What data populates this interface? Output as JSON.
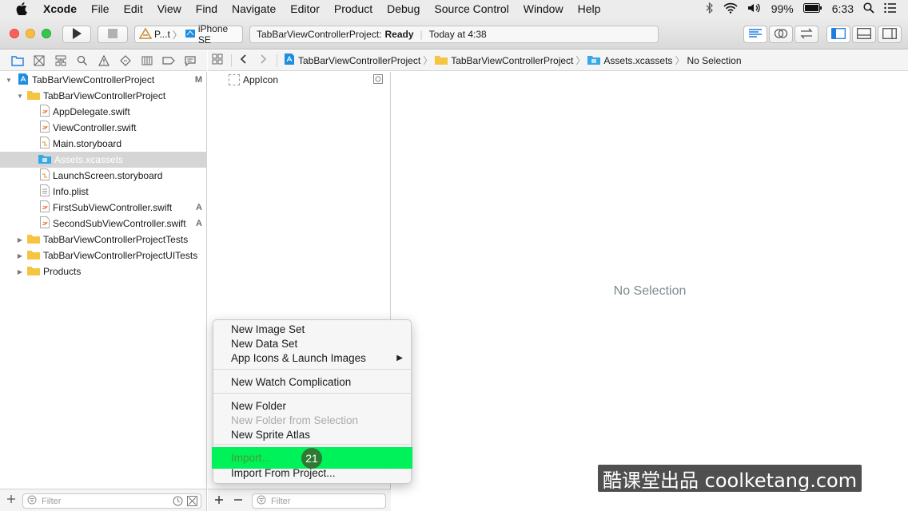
{
  "menubar": {
    "app": "Xcode",
    "items": [
      "File",
      "Edit",
      "View",
      "Find",
      "Navigate",
      "Editor",
      "Product",
      "Debug",
      "Source Control",
      "Window",
      "Help"
    ],
    "battery": "99%",
    "time": "6:33"
  },
  "toolbar": {
    "scheme_target": "P...t",
    "scheme_device": "iPhone SE",
    "status_project": "TabBarViewControllerProject:",
    "status_state": "Ready",
    "status_time": "Today at 4:38"
  },
  "jumpbar": {
    "crumbs": [
      "TabBarViewControllerProject",
      "TabBarViewControllerProject",
      "Assets.xcassets",
      "No Selection"
    ]
  },
  "navigator": {
    "rows": [
      {
        "label": "TabBarViewControllerProject",
        "badge": "M",
        "icon": "project-icon"
      },
      {
        "label": "TabBarViewControllerProject",
        "badge": "",
        "icon": "folder-icon"
      },
      {
        "label": "AppDelegate.swift",
        "badge": "",
        "icon": "swift-file-icon"
      },
      {
        "label": "ViewController.swift",
        "badge": "",
        "icon": "swift-file-icon"
      },
      {
        "label": "Main.storyboard",
        "badge": "",
        "icon": "storyboard-icon"
      },
      {
        "label": "Assets.xcassets",
        "badge": "",
        "icon": "asset-catalog-icon"
      },
      {
        "label": "LaunchScreen.storyboard",
        "badge": "",
        "icon": "storyboard-icon"
      },
      {
        "label": "Info.plist",
        "badge": "",
        "icon": "plist-icon"
      },
      {
        "label": "FirstSubViewController.swift",
        "badge": "A",
        "icon": "swift-file-icon"
      },
      {
        "label": "SecondSubViewController.swift",
        "badge": "A",
        "icon": "swift-file-icon"
      },
      {
        "label": "TabBarViewControllerProjectTests",
        "badge": "",
        "icon": "folder-icon"
      },
      {
        "label": "TabBarViewControllerProjectUITests",
        "badge": "",
        "icon": "folder-icon"
      },
      {
        "label": "Products",
        "badge": "",
        "icon": "folder-icon"
      }
    ],
    "filter_placeholder": "Filter"
  },
  "assetlist": {
    "items": [
      "AppIcon"
    ],
    "filter_placeholder": "Filter"
  },
  "editor": {
    "empty_text": "No Selection"
  },
  "context_menu": {
    "items": {
      "new_image_set": "New Image Set",
      "new_data_set": "New Data Set",
      "app_icons": "App Icons & Launch Images",
      "watch_complication": "New Watch Complication",
      "new_folder": "New Folder",
      "new_folder_selection": "New Folder from Selection",
      "sprite_atlas": "New Sprite Atlas",
      "import": "Import...",
      "import_project": "Import From Project..."
    },
    "step_number": "21"
  },
  "watermark": "酷课堂出品 coolketang.com",
  "colors": {
    "highlight": "#00f25a",
    "step_badge": "#2f7a32",
    "selection_row": "#d5d5d5",
    "folder": "#f5c542",
    "xcode_blue": "#1e8fe0"
  }
}
